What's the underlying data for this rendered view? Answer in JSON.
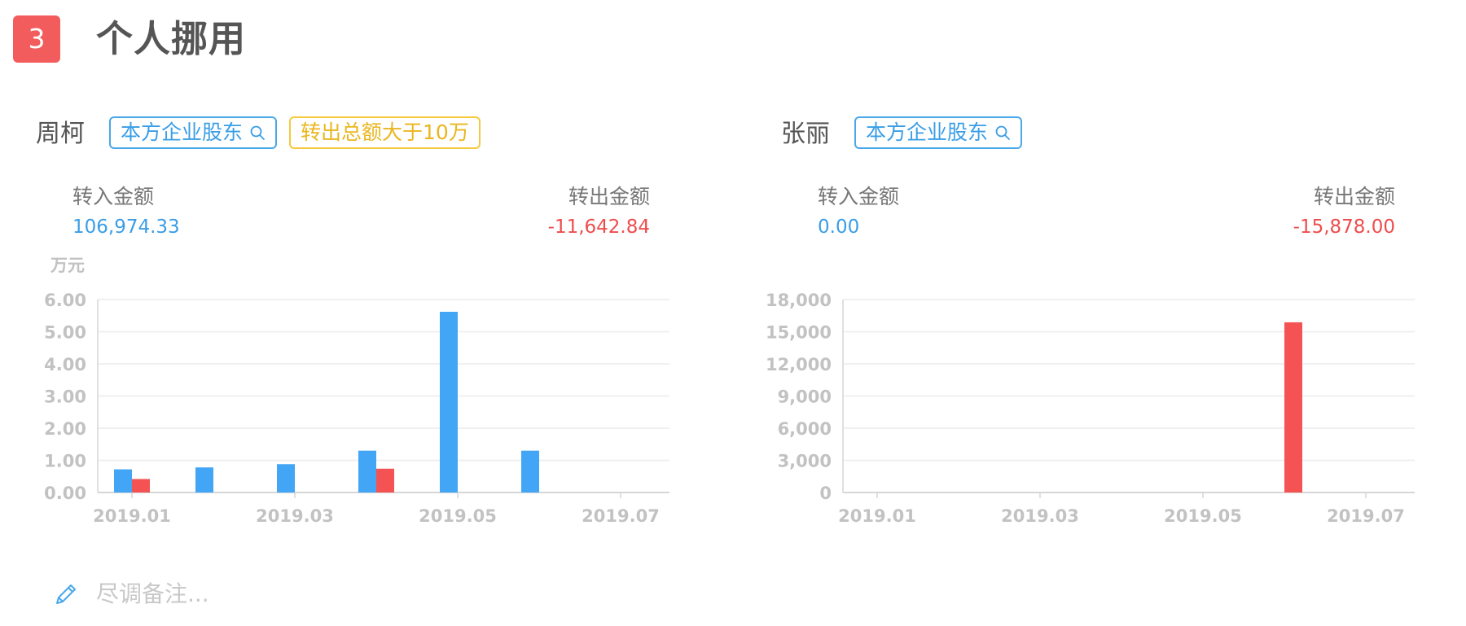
{
  "section": {
    "number": "3",
    "title": "个人挪用"
  },
  "panels": [
    {
      "person_name": "周柯",
      "tags": [
        {
          "label": "本方企业股东",
          "style": "blue",
          "icon": "search-icon"
        },
        {
          "label": "转出总额大于10万",
          "style": "yellow",
          "icon": ""
        }
      ],
      "income_label": "转入金额",
      "income_value": "106,974.33",
      "outgo_label": "转出金额",
      "outgo_value": "-11,642.84"
    },
    {
      "person_name": "张丽",
      "tags": [
        {
          "label": "本方企业股东",
          "style": "blue",
          "icon": "search-icon"
        }
      ],
      "income_label": "转入金额",
      "income_value": "0.00",
      "outgo_label": "转出金额",
      "outgo_value": "-15,878.00"
    }
  ],
  "remark": {
    "placeholder": "尽调备注...",
    "icon": "pencil-icon"
  },
  "colors": {
    "income": "#42a5f5",
    "outgo": "#f55353",
    "badge": "#f35c5c",
    "axis_text": "#c2c2c2",
    "grid": "#ececec"
  },
  "chart_data": [
    {
      "type": "bar",
      "unit_label": "万元",
      "ylim": [
        0,
        6
      ],
      "yticks": [
        "0.00",
        "1.00",
        "2.00",
        "3.00",
        "4.00",
        "5.00",
        "6.00"
      ],
      "xticks": [
        "2019.01",
        "2019.03",
        "2019.05",
        "2019.07"
      ],
      "categories": [
        "2019.01",
        "2019.02",
        "2019.03",
        "2019.04",
        "2019.05",
        "2019.06",
        "2019.07"
      ],
      "series": [
        {
          "key": "income",
          "values": [
            0.72,
            0.78,
            0.88,
            1.3,
            5.62,
            1.3,
            0
          ]
        },
        {
          "key": "outgo",
          "values": [
            0.42,
            0,
            0,
            0.74,
            0,
            0,
            0
          ]
        }
      ],
      "grid": true
    },
    {
      "type": "bar",
      "unit_label": "",
      "ylim": [
        0,
        18000
      ],
      "yticks": [
        "0",
        "3,000",
        "6,000",
        "9,000",
        "12,000",
        "15,000",
        "18,000"
      ],
      "xticks": [
        "2019.01",
        "2019.03",
        "2019.05",
        "2019.07"
      ],
      "categories": [
        "2019.01",
        "2019.02",
        "2019.03",
        "2019.04",
        "2019.05",
        "2019.06",
        "2019.07"
      ],
      "series": [
        {
          "key": "income",
          "values": [
            0,
            0,
            0,
            0,
            0,
            0,
            0
          ]
        },
        {
          "key": "outgo",
          "values": [
            0,
            0,
            0,
            0,
            0,
            15878,
            0
          ]
        }
      ],
      "grid": true
    }
  ]
}
